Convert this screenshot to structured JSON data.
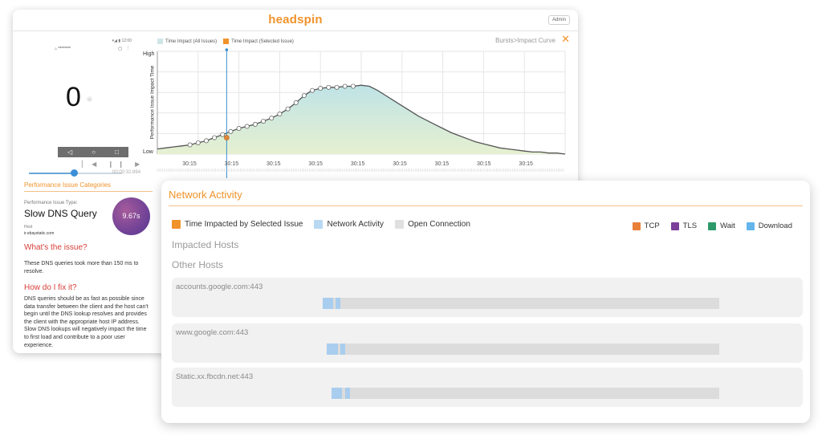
{
  "header": {
    "brand": "headspin",
    "admin": "Admin"
  },
  "device": {
    "status": "▾◢ ▮ 12:00",
    "url": "⌂ ********",
    "counter": "0",
    "counter_badge": "×",
    "nav": [
      "◁",
      "○",
      "□"
    ],
    "controls": "▏◀ ❙❙ ▶",
    "time": "00:00:32.894",
    "progress": 0.48
  },
  "performance": {
    "heading": "Performance Issue Categories",
    "issue_type_label": "Performance Issue Type:",
    "issue_type": "Slow DNS Query",
    "score": "9.67s",
    "host_label": "Host",
    "host": "ir.ebaystatic.com",
    "q1": "What's the issue?",
    "a1": "These DNS queries took more than 150 ms to resolve.",
    "q2": "How do I fix it?",
    "a2": "DNS queries should be as fast as possible since data transfer between the client and the host can't begin until the DNS lookup resolves and provides the client with the appropriate host IP address. Slow DNS lookups will negatively impact the time to first load and contribute to a poor user experience."
  },
  "chart_data": {
    "type": "area",
    "title": "Bursts>Impact Curve",
    "legend": [
      {
        "label": "Time Impact (All Issues)",
        "color": "#cfe6e8"
      },
      {
        "label": "Time Impact (Selected Issue)",
        "color": "#f0932b"
      }
    ],
    "ylabel": "Performance Issue Impact Time",
    "y_high": "High",
    "y_low": "Low",
    "x_tick_labels": [
      "30:15",
      "30:15",
      "30:15",
      "30:15",
      "30:15",
      "30:15",
      "30:15",
      "30:15",
      "30:15"
    ],
    "x": [
      0,
      2,
      4,
      6,
      8,
      10,
      12,
      14,
      16,
      18,
      20,
      22,
      24,
      26,
      28,
      30,
      32,
      34,
      36,
      38,
      40,
      42,
      44,
      46,
      48,
      50,
      52,
      54,
      56,
      58,
      60,
      62,
      64,
      66,
      68,
      70,
      72,
      74,
      76,
      78,
      80,
      82,
      84,
      86,
      88,
      90,
      92,
      94,
      96,
      98,
      100
    ],
    "y": [
      0.05,
      0.06,
      0.07,
      0.08,
      0.09,
      0.11,
      0.13,
      0.16,
      0.19,
      0.22,
      0.25,
      0.27,
      0.29,
      0.32,
      0.35,
      0.39,
      0.44,
      0.5,
      0.57,
      0.62,
      0.64,
      0.65,
      0.65,
      0.66,
      0.66,
      0.67,
      0.66,
      0.62,
      0.57,
      0.52,
      0.47,
      0.42,
      0.37,
      0.33,
      0.29,
      0.25,
      0.21,
      0.18,
      0.15,
      0.12,
      0.1,
      0.08,
      0.06,
      0.05,
      0.04,
      0.03,
      0.02,
      0.02,
      0.01,
      0.01,
      0.0
    ],
    "point_range": [
      7,
      49
    ],
    "selected_x": 17,
    "selected_y": 0.16,
    "ylim": [
      0,
      1
    ],
    "xlim": [
      0,
      100
    ]
  },
  "network": {
    "title": "Network Activity",
    "legend_left": [
      {
        "label": "Time Impacted by Selected Issue",
        "color": "#f0932b"
      },
      {
        "label": "Network Activity",
        "color": "#b9d8f2"
      },
      {
        "label": "Open Connection",
        "color": "#e0e0e0"
      }
    ],
    "legend_right": [
      {
        "label": "TCP",
        "color": "#e8803a"
      },
      {
        "label": "TLS",
        "color": "#7b3f9a"
      },
      {
        "label": "Wait",
        "color": "#2e9a6b"
      },
      {
        "label": "Download",
        "color": "#63b5ec"
      }
    ],
    "impacted_hosts": "Impacted Hosts",
    "other_hosts": "Other Hosts",
    "hosts": [
      {
        "name": "accounts.google.com:443",
        "start": 0.0,
        "blocks": [
          [
            0.0,
            0.027
          ],
          [
            0.033,
            0.045
          ]
        ]
      },
      {
        "name": "www.google.com:443",
        "start": 0.011,
        "blocks": [
          [
            0.011,
            0.038
          ],
          [
            0.045,
            0.057
          ]
        ]
      },
      {
        "name": "Static.xx.fbcdn.net:443",
        "start": 0.022,
        "blocks": [
          [
            0.022,
            0.049
          ],
          [
            0.056,
            0.068
          ]
        ]
      }
    ]
  }
}
